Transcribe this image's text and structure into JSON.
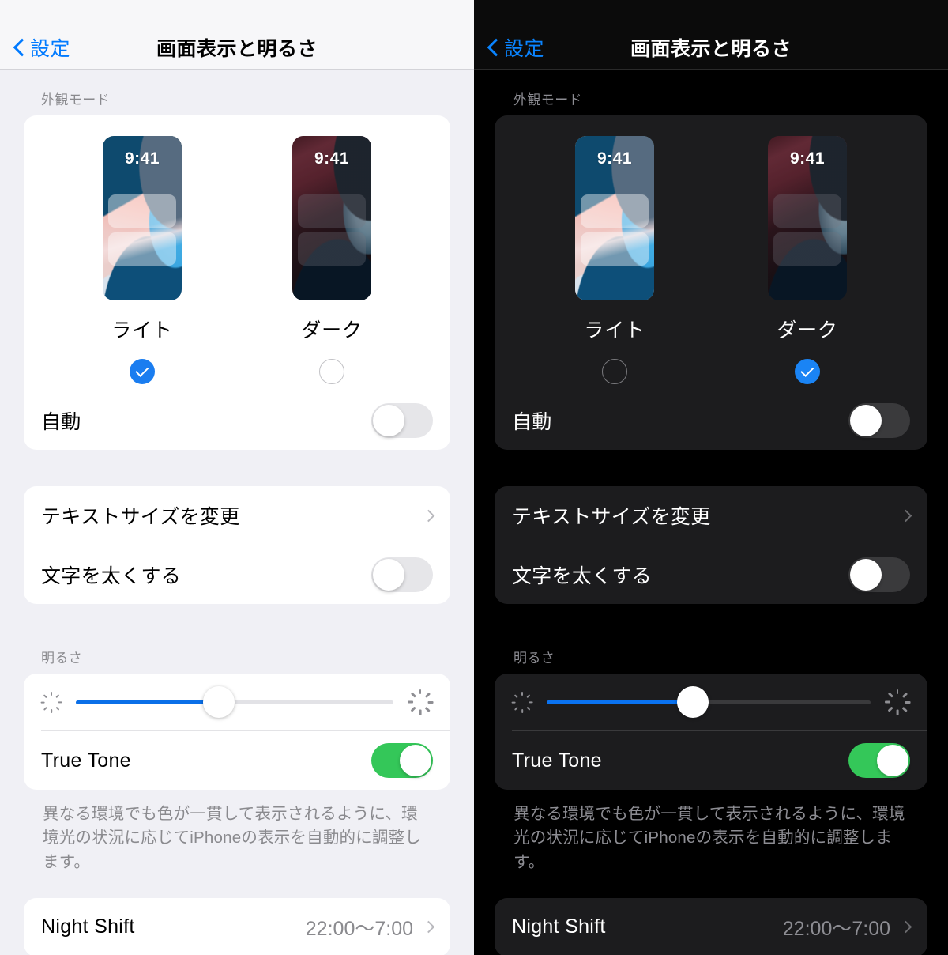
{
  "panels": [
    {
      "theme": "light",
      "nav": {
        "back_label": "設定",
        "back_icon": "chevron-left-icon",
        "title": "画面表示と明るさ"
      },
      "appearance": {
        "section_label": "外観モード",
        "options": [
          {
            "label": "ライト",
            "time": "9:41",
            "selected": true
          },
          {
            "label": "ダーク",
            "time": "9:41",
            "selected": false
          }
        ],
        "auto_label": "自動",
        "auto_on": false
      },
      "text": {
        "text_size_label": "テキストサイズを変更",
        "bold_label": "文字を太くする",
        "bold_on": false
      },
      "brightness": {
        "section_label": "明るさ",
        "value_percent": 45,
        "low_icon": "sun-low-icon",
        "high_icon": "sun-high-icon",
        "true_tone_label": "True Tone",
        "true_tone_on": true,
        "footnote": "異なる環境でも色が一貫して表示されるように、環境光の状況に応じてiPhoneの表示を自動的に調整します。"
      },
      "night_shift": {
        "label": "Night Shift",
        "value": "22:00〜7:00"
      }
    },
    {
      "theme": "dark",
      "nav": {
        "back_label": "設定",
        "back_icon": "chevron-left-icon",
        "title": "画面表示と明るさ"
      },
      "appearance": {
        "section_label": "外観モード",
        "options": [
          {
            "label": "ライト",
            "time": "9:41",
            "selected": false
          },
          {
            "label": "ダーク",
            "time": "9:41",
            "selected": true
          }
        ],
        "auto_label": "自動",
        "auto_on": false
      },
      "text": {
        "text_size_label": "テキストサイズを変更",
        "bold_label": "文字を太くする",
        "bold_on": false
      },
      "brightness": {
        "section_label": "明るさ",
        "value_percent": 45,
        "low_icon": "sun-low-icon",
        "high_icon": "sun-high-icon",
        "true_tone_label": "True Tone",
        "true_tone_on": true,
        "footnote": "異なる環境でも色が一貫して表示されるように、環境光の状況に応じてiPhoneの表示を自動的に調整します。"
      },
      "night_shift": {
        "label": "Night Shift",
        "value": "22:00〜7:00"
      }
    }
  ],
  "colors": {
    "accent_blue": "#007aff",
    "toggle_on_green": "#34c759",
    "slider_fill": "#0a6fe8",
    "light_bg": "#f0f0f5",
    "light_card": "#ffffff",
    "dark_bg": "#000000",
    "dark_card": "#1c1c1e"
  }
}
